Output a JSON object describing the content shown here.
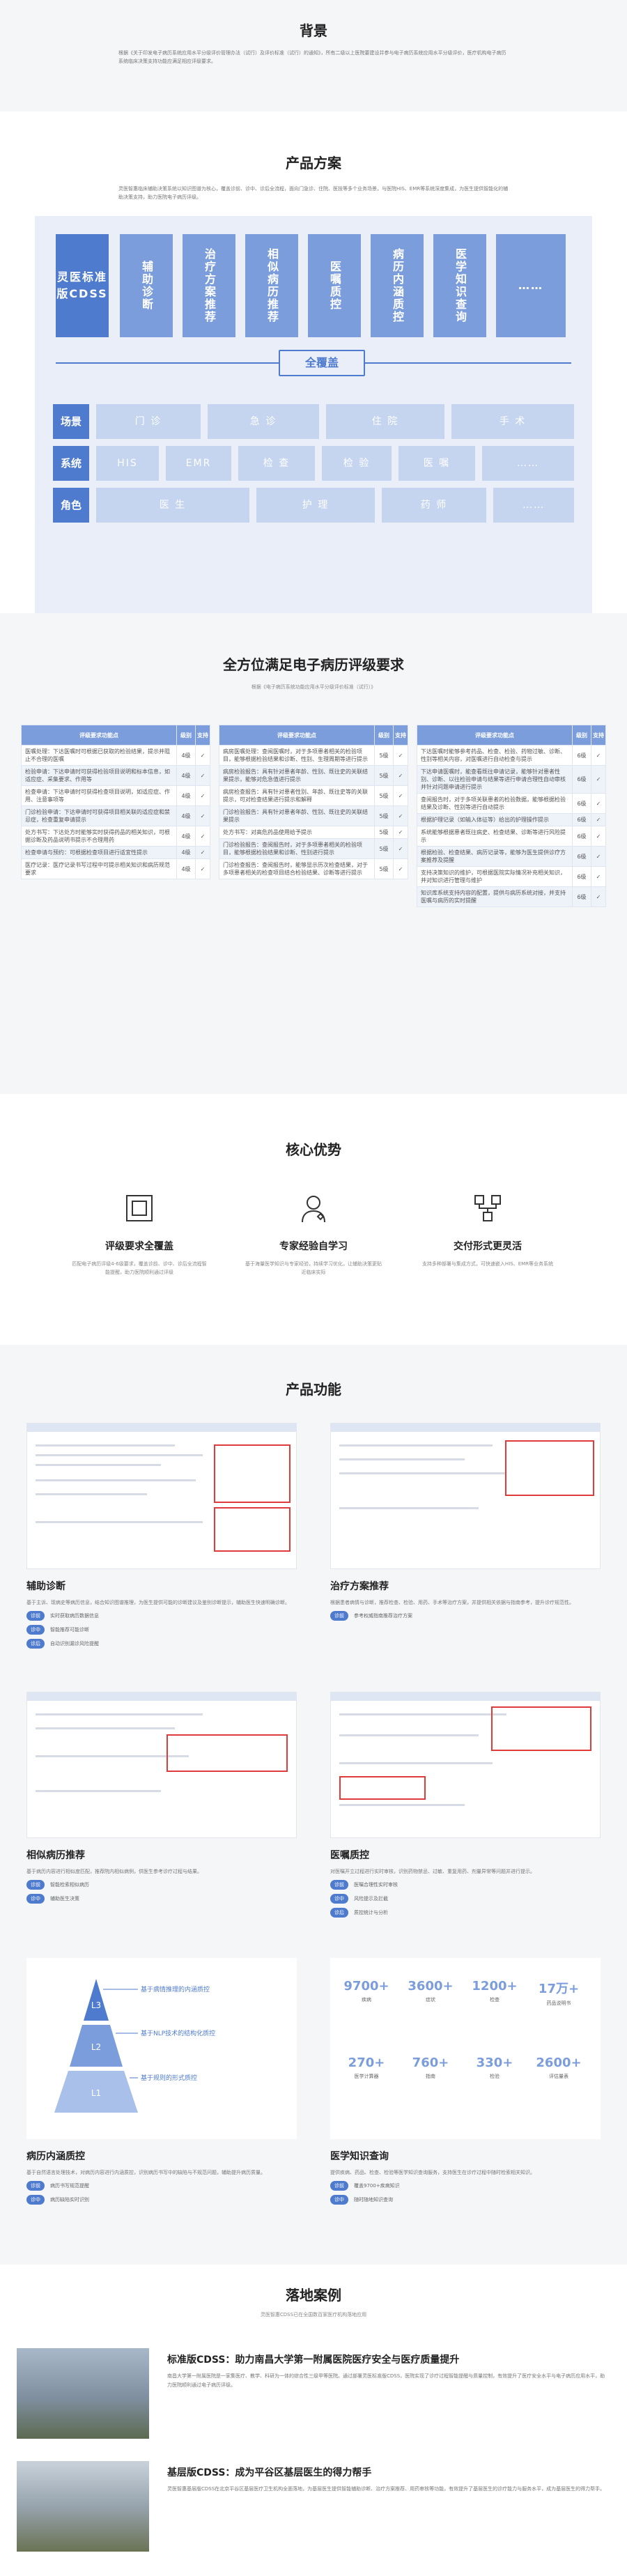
{
  "background": {
    "title": "背景",
    "text": "根据《关于印发电子病历系统应用水平分级评价管理办法（试行）及评价标准（试行）的通知》，所有二级以上医院要建设并参与电子病历系统应用水平分级评价，医疗机构电子病历系统临床决策支持功能应满足相应评级要求。"
  },
  "plan": {
    "title": "产品方案",
    "text": "灵医智惠临床辅助决策系统以知识图谱为核心，覆盖诊前、诊中、诊后全流程，面向门急诊、住院、医技等多个业务场景，与医院HIS、EMR等系统深度集成，为医生提供智能化的辅助决策支持，助力医院电子病历评级。",
    "modules": [
      "灵医标准版CDSS",
      "辅助诊断",
      "治疗方案推荐",
      "相似病历推荐",
      "医嘱质控",
      "病历内涵质控",
      "医学知识查询",
      "……"
    ],
    "cover_label": "全覆盖",
    "rows": [
      {
        "label": "场景",
        "cells": [
          "门 诊",
          "急 诊",
          "住 院",
          "手 术"
        ]
      },
      {
        "label": "系统",
        "cells": [
          "HIS",
          "EMR",
          "检 查",
          "检 验",
          "医 嘱",
          "……"
        ]
      },
      {
        "label": "角色",
        "cells": [
          "医 生",
          "护 理",
          "药 师",
          "……"
        ]
      }
    ]
  },
  "reqs": {
    "title": "全方位满足电子病历评级要求",
    "desc": "根据《电子病历系统功能应用水平分级评价标准（试行）》",
    "headers": [
      "评级要求功能点",
      "级别",
      "支持"
    ],
    "tables": [
      [
        {
          "text": "医嘱处理：下达医嘱时可根据已获取的检验结果，提示并阻止不合理的医嘱",
          "level": "4级",
          "ok": "✓"
        },
        {
          "text": "检验申请：下达申请时可获得检验项目说明和标本信息，如适应症、采集要求、作用等",
          "level": "4级",
          "ok": "✓"
        },
        {
          "text": "检查申请：下达申请时可获得检查项目说明，如适应症、作用、注意事项等",
          "level": "4级",
          "ok": "✓"
        },
        {
          "text": "门诊检验申请：下达申请时可获得项目相关联的适应症和禁忌症，检查重复申请提示",
          "level": "4级",
          "ok": "✓"
        },
        {
          "text": "处方书写：下达处方时能够实时获得药品的相关知识，可根据诊断及药品说明书提示不合理用药",
          "level": "4级",
          "ok": "✓"
        },
        {
          "text": "检查申请与预约：可根据检查项目进行适宜性提示",
          "level": "4级",
          "ok": "✓"
        },
        {
          "text": "医疗记录：医疗记录书写过程中可提示相关知识和病历规范要求",
          "level": "4级",
          "ok": "✓"
        }
      ],
      [
        {
          "text": "病房医嘱处理：查阅医嘱时，对于多项患者相关的检验项目，能够根据检验结果和诊断、性别、生理周期等进行提示",
          "level": "5级",
          "ok": "✓"
        },
        {
          "text": "病房检验报告：具有针对患者年龄、性别、既往史的关联结果提示，能够对危急值进行提示",
          "level": "5级",
          "ok": "✓"
        },
        {
          "text": "病房检查报告：具有针对患者性别、年龄、既往史等的关联提示，可对检查结果进行提示和解释",
          "level": "5级",
          "ok": "✓"
        },
        {
          "text": "门诊检验报告：具有针对患者年龄、性别、既往史的关联结果提示",
          "level": "5级",
          "ok": "✓"
        },
        {
          "text": "处方书写：对高危药品使用给予提示",
          "level": "5级",
          "ok": "✓"
        },
        {
          "text": "门诊检验报告：查阅报告时，对于多项患者相关的检验项目，能够根据检验结果和诊断、性别进行提示",
          "level": "5级",
          "ok": "✓"
        },
        {
          "text": "门诊检查报告：查阅报告时，能够显示历次检查结果，对于多项患者相关的检查项目结合检验结果、诊断等进行提示",
          "level": "5级",
          "ok": "✓"
        }
      ],
      [
        {
          "text": "下达医嘱时能够参考药品、检查、检验、药物过敏、诊断、性别等相关内容，对医嘱进行自动检查与提示",
          "level": "6级",
          "ok": "✓"
        },
        {
          "text": "下达申请医嘱时，能查看既往申请记录，能够针对患者性别、诊断、以往检验申请与结果等进行申请合理性自动审核并针对问题申请进行提示",
          "level": "6级",
          "ok": "✓"
        },
        {
          "text": "查阅报告时，对于多项关联患者的检验数据，能够根据检验结果及诊断、性别等进行自动提示",
          "level": "6级",
          "ok": "✓"
        },
        {
          "text": "根据护理记录（如输入体征等）给出的护理操作提示",
          "level": "6级",
          "ok": "✓"
        },
        {
          "text": "系统能够根据患者既往病史、检查结果、诊断等进行风险提示",
          "level": "6级",
          "ok": "✓"
        },
        {
          "text": "根据检验、检查结果、病历记录等，能够为医生提供诊疗方案推荐及提醒",
          "level": "6级",
          "ok": "✓"
        },
        {
          "text": "支持决策知识的维护，可根据医院实际情况补充相关知识，并对知识进行管理与维护",
          "level": "6级",
          "ok": "✓"
        },
        {
          "text": "知识库系统支持内容的配置，提供与病历系统对接，并支持医嘱与病历的实时提醒",
          "level": "6级",
          "ok": "✓"
        }
      ]
    ]
  },
  "adv": {
    "title": "核心优势",
    "items": [
      {
        "name": "评级要求全覆盖",
        "desc": "匹配电子病历评级4-6级要求，覆盖诊前、诊中、诊后全流程智能提醒，助力医院顺利通过评级"
      },
      {
        "name": "专家经验自学习",
        "desc": "基于海量医学知识与专家经验，持续学习优化，让辅助决策更贴近临床实际"
      },
      {
        "name": "交付形式更灵活",
        "desc": "支持多种部署与集成方式，可快速嵌入HIS、EMR等业务系统"
      }
    ]
  },
  "func": {
    "title": "产品功能",
    "cards": [
      {
        "name": "辅助诊断",
        "desc": "基于主诉、现病史等病历信息，结合知识图谱推理，为医生提供可能的诊断建议及鉴别诊断提示，辅助医生快速明确诊断。",
        "tags": [
          {
            "t": "诊前",
            "d": "实时获取病历数据信息"
          },
          {
            "t": "诊中",
            "d": "智能推荐可能诊断"
          },
          {
            "t": "诊后",
            "d": "自动识别漏诊风险提醒"
          }
        ]
      },
      {
        "name": "治疗方案推荐",
        "desc": "根据患者病情与诊断，推荐检查、检验、用药、手术等治疗方案，并提供相关依据与指南参考，提升诊疗规范性。",
        "tags": [
          {
            "t": "诊前",
            "d": "参考权威指南推荐治疗方案"
          }
        ]
      },
      {
        "name": "相似病历推荐",
        "desc": "基于病历内容进行相似度匹配，推荐院内相似病例，供医生参考诊疗过程与结果。",
        "tags": [
          {
            "t": "诊前",
            "d": "智能检索相似病历"
          },
          {
            "t": "诊中",
            "d": "辅助医生决策"
          }
        ]
      },
      {
        "name": "医嘱质控",
        "desc": "对医嘱开立过程进行实时审核，识别药物禁忌、过敏、重复用药、剂量异常等问题并进行提示。",
        "tags": [
          {
            "t": "诊前",
            "d": "医嘱合理性实时审核"
          },
          {
            "t": "诊中",
            "d": "风险提示及拦截"
          },
          {
            "t": "诊后",
            "d": "质控统计与分析"
          }
        ]
      },
      {
        "name": "病历内涵质控",
        "desc": "基于自然语言处理技术，对病历内容进行内涵质控，识别病历书写中的缺陷与不规范问题，辅助提升病历质量。",
        "tags": [
          {
            "t": "诊前",
            "d": "病历书写规范提醒"
          },
          {
            "t": "诊中",
            "d": "病历缺陷实时识别"
          }
        ]
      },
      {
        "name": "医学知识查询",
        "desc": "提供疾病、药品、检查、检验等医学知识查询服务，支持医生在诊疗过程中随时检索相关知识。",
        "tags": [
          {
            "t": "诊前",
            "d": "覆盖9700+疾病知识"
          },
          {
            "t": "诊中",
            "d": "随时随地知识查询"
          }
        ]
      }
    ],
    "pyramid": [
      "L3",
      "L2",
      "L1"
    ],
    "pyramid_notes": [
      "基于病情推理的内涵质控",
      "基于NLP技术的结构化质控",
      "基于规则的形式质控"
    ],
    "stats": [
      {
        "num": "9700+",
        "lbl": "疾病"
      },
      {
        "num": "3600+",
        "lbl": "症状"
      },
      {
        "num": "1200+",
        "lbl": "检查"
      },
      {
        "num": "17万+",
        "lbl": "药品说明书"
      },
      {
        "num": "270+",
        "lbl": "医学计算器"
      },
      {
        "num": "760+",
        "lbl": "指南"
      },
      {
        "num": "330+",
        "lbl": "检验"
      },
      {
        "num": "2600+",
        "lbl": "评估量表"
      }
    ]
  },
  "cases": {
    "title": "落地案例",
    "desc": "灵医智惠CDSS已在全国数百家医疗机构落地应用",
    "items": [
      {
        "title": "标准版CDSS：助力南昌大学第一附属医院医疗安全与医疗质量提升",
        "desc": "南昌大学第一附属医院是一家集医疗、教学、科研为一体的综合性三级甲等医院。通过部署灵医标准版CDSS，医院实现了诊疗过程智能提醒与质量控制，有效提升了医疗安全水平与电子病历应用水平，助力医院顺利通过电子病历评级。"
      },
      {
        "title": "基层版CDSS：成为平谷区基层医生的得力帮手",
        "desc": "灵医智惠基层版CDSS在北京平谷区基层医疗卫生机构全面落地，为基层医生提供智能辅助诊断、治疗方案推荐、用药审核等功能，有效提升了基层医生的诊疗能力与服务水平，成为基层医生的得力帮手。"
      }
    ]
  }
}
